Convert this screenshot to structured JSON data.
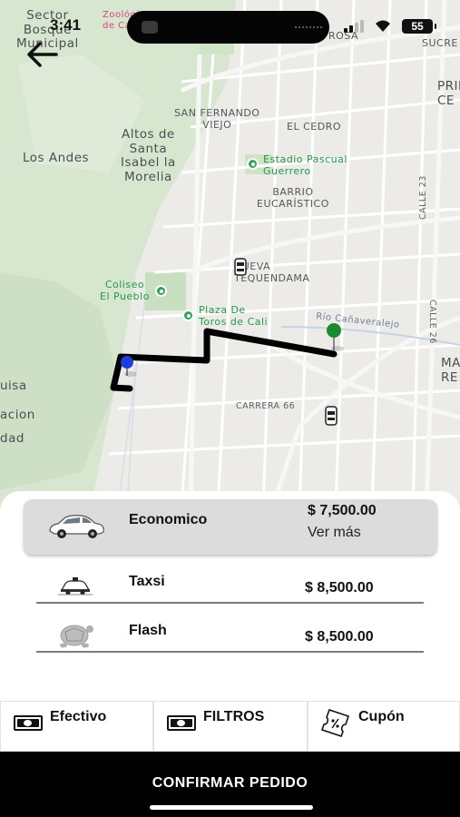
{
  "status_bar": {
    "time": "3:41",
    "battery": "55"
  },
  "map": {
    "labels": {
      "sector_bosque": "Sector\nBosque\nMunicipal",
      "zoologico": "Zoológico\nde Cali",
      "rosa": "ROSA",
      "sucre": "SUCRE",
      "prim": "PRIM\nCE",
      "san_fernando": "SAN FERNANDO\nVIEJO",
      "el_cedro": "EL CEDRO",
      "altos_santa_isabel": "Altos de\nSanta\nIsabel la\nMorelia",
      "los_andes": "Los Andes",
      "estadio": "Estadio Pascual\nGuerrero",
      "barrio_eucaristico": "BARRIO\nEUCARÍSTICO",
      "calle_23": "CALLE 23",
      "nueva_tequendama": "NUEVA\nTEQUENDAMA",
      "calle_26": "CALLE 26",
      "coliseo": "Coliseo\nEl Pueblo",
      "plaza_toros": "Plaza De\nToros de Cali",
      "canaveralejo": "Río Cañaveralejo",
      "mar": "MAR\nRE",
      "uisa": "uisa",
      "carrera_66": "CARRERA 66",
      "acion": "acion",
      "dad": "dad"
    }
  },
  "services": [
    {
      "name": "Economico",
      "price": "$ 7,500.00",
      "more": "Ver más",
      "icon": "taxi-car-icon",
      "selected": true
    },
    {
      "name": "Taxsi",
      "price": "$ 8,500.00",
      "icon": "taxi-icon",
      "selected": false
    },
    {
      "name": "Flash",
      "price": "$ 8,500.00",
      "icon": "turtle-icon",
      "selected": false
    }
  ],
  "payment_tabs": [
    {
      "label": "Efectivo",
      "icon": "cash-icon"
    },
    {
      "label": "FILTROS",
      "icon": "cash-icon"
    },
    {
      "label": "Cupón",
      "icon": "coupon-icon"
    }
  ],
  "confirm_label": "CONFIRMAR PEDIDO",
  "colors": {
    "route": "#000000",
    "origin_pin": "#1a3fe0",
    "destination_pin": "#1a8a2e",
    "poi": "#2ea65a"
  }
}
